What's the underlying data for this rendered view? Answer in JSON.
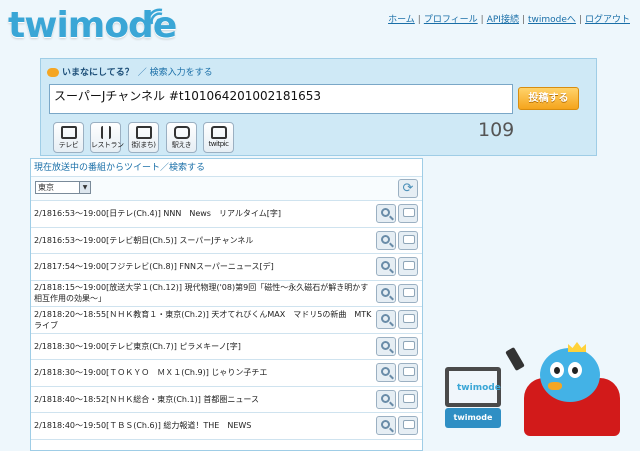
{
  "logo": "twimode",
  "nav": {
    "items": [
      "ホーム",
      "プロフィール",
      "API接続",
      "twimodeへ",
      "ログアウト"
    ],
    "separator": "|"
  },
  "compose": {
    "prompt": "いまなにしてる？",
    "search_link": "／ 検索入力をする",
    "text_value": "スーパーJチャンネル #t101064201002181653",
    "post_button": "投稿する",
    "char_count": "109",
    "categories": [
      {
        "icon": "tv-icon",
        "label": "テレビ"
      },
      {
        "icon": "restaurant-icon",
        "label": "レストラン"
      },
      {
        "icon": "town-icon",
        "label": "街(まち)"
      },
      {
        "icon": "station-icon",
        "label": "駅えき"
      },
      {
        "icon": "camera-icon",
        "label": "twitpic"
      }
    ]
  },
  "programs": {
    "header": "現在放送中の番組からツイート／検索する",
    "region": "東京",
    "rows": [
      "2/1816:53～19:00[日テレ(Ch.4)] NNN　News　リアルタイム[字]",
      "2/1816:53～19:00[テレビ朝日(Ch.5)] スーパーJチャンネル",
      "2/1817:54～19:00[フジテレビ(Ch.8)] FNNスーパーニュース[デ]",
      "2/1818:15～19:00[放送大学１(Ch.12)] 現代物理('08)第9回「磁性～永久磁石が解き明かす相互作用の効果～」",
      "2/1818:20～18:55[ＮＨＫ教育１・東京(Ch.2)] 天才てれびくんMAX　マドリ5の新曲　MTKライブ",
      "2/1818:30～19:00[テレビ東京(Ch.7)] ピラメキーノ[字]",
      "2/1818:30～19:00[ＴＯＫＹＯ　ＭＸ１(Ch.9)] じゃりン子チエ",
      "2/1818:40～18:52[ＮＨＫ総合・東京(Ch.1)] 首都圏ニュース",
      "2/1818:40～19:50[ＴＢＳ(Ch.6)] 総力報道！THE　NEWS"
    ]
  },
  "tv_mascot": {
    "screen_logo": "twimode",
    "base_logo": "twimode"
  }
}
